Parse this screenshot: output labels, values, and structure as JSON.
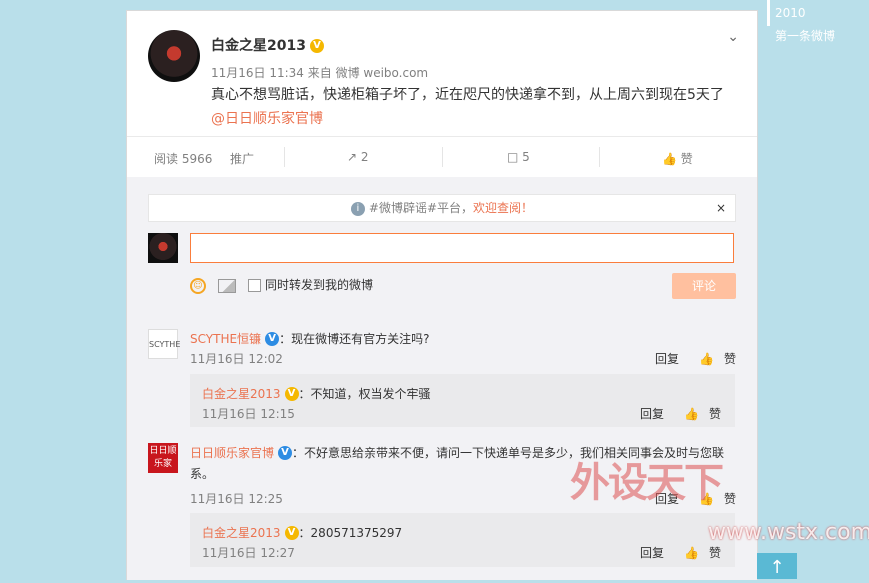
{
  "sidebar": {
    "year": "2010",
    "first_post": "第一条微博"
  },
  "post": {
    "username": "白金之星2013",
    "verified_badge": "V",
    "meta": "11月16日 11:34 来自 微博 weibo.com",
    "text": "真心不想骂脏话，快递柜箱子坏了，近在咫尺的快递拿不到，从上周六到现在5天了",
    "mention": "@日日顺乐家官博"
  },
  "actions": {
    "reads": "阅读 5966",
    "promote": "推广",
    "repost_count": "2",
    "comment_count": "5",
    "like_label": "赞"
  },
  "comment_area": {
    "notice_prefix": "#微博辟谣#平台，",
    "notice_link": "欢迎查阅！",
    "notice_close": "×",
    "checkbox_label": "同时转发到我的微博",
    "submit_label": "评论",
    "input_value": ""
  },
  "comments": [
    {
      "name": "SCYTHE恒镰",
      "text": "：现在微博还有官方关注吗?",
      "time": "11月16日 12:02",
      "reply_label": "回复",
      "like_label": "赞",
      "reply": {
        "name": "白金之星2013",
        "text": "：不知道，权当发个牢骚",
        "time": "11月16日 12:15",
        "reply_label": "回复",
        "like_label": "赞"
      }
    },
    {
      "name": "日日顺乐家官博",
      "text": "：不好意思给亲带来不便，请问一下快递单号是多少，我们相关同事会及时与您联系。",
      "time": "11月16日 12:25",
      "reply_label": "回复",
      "like_label": "赞",
      "reply": {
        "name": "白金之星2013",
        "text": "：280571375297",
        "time": "11月16日 12:27",
        "reply_label": "回复",
        "like_label": "赞"
      }
    }
  ],
  "avatar_logo": {
    "line1": "日日顺",
    "line2": "乐家"
  },
  "watermark": {
    "text": "外设天下",
    "url": "www.wstx.com"
  },
  "colors": {
    "accent": "#eb7350",
    "link_orange": "#eb7350",
    "bg": "#b9dfea"
  }
}
